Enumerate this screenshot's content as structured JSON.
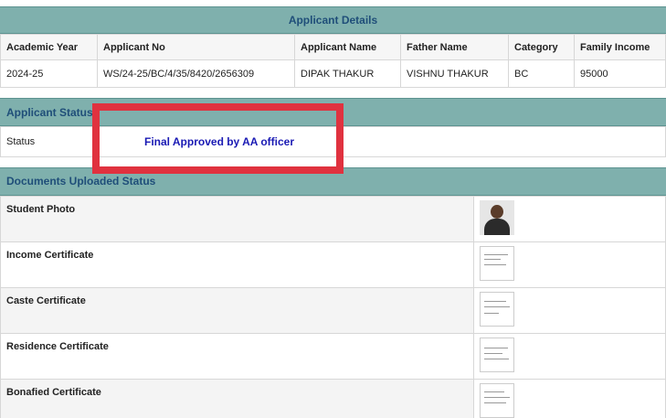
{
  "applicant_details": {
    "title": "Applicant Details",
    "columns": [
      "Academic Year",
      "Applicant No",
      "Applicant Name",
      "Father Name",
      "Category",
      "Family Income"
    ],
    "row": [
      "2024-25",
      "WS/24-25/BC/4/35/8420/2656309",
      "DIPAK THAKUR",
      "VISHNU THAKUR",
      "BC",
      "95000"
    ]
  },
  "applicant_status": {
    "title": "Applicant Status",
    "label": "Status",
    "value": "Final Approved by AA officer"
  },
  "documents": {
    "title": "Documents Uploaded Status",
    "items": [
      {
        "label": "Student Photo",
        "thumb": "photo-thumbnail"
      },
      {
        "label": "Income Certificate",
        "thumb": "document-thumbnail"
      },
      {
        "label": "Caste Certificate",
        "thumb": "document-thumbnail"
      },
      {
        "label": "Residence Certificate",
        "thumb": "document-thumbnail"
      },
      {
        "label": "Bonafied Certificate",
        "thumb": "document-thumbnail"
      }
    ]
  },
  "annotation": {
    "color": "#e0323f"
  },
  "colors": {
    "header_bg": "#7fb0ad",
    "header_text": "#1f4e79",
    "status_text": "#1a1ab4"
  }
}
